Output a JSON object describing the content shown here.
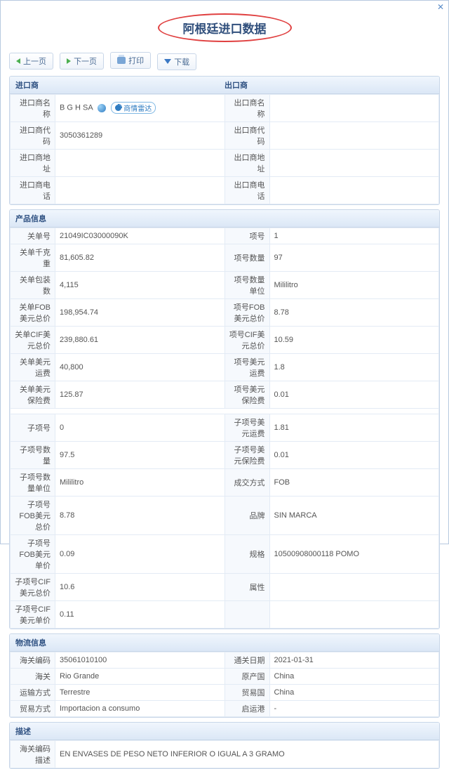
{
  "title": "阿根廷进口数据",
  "toolbar": {
    "prev": "上一页",
    "next": "下一页",
    "print": "打印",
    "download": "下载"
  },
  "sections": {
    "importer": "进口商",
    "exporter": "出口商",
    "product": "产品信息",
    "logistics": "物流信息",
    "description": "描述"
  },
  "radar_label": "商情雷达",
  "imp": {
    "name_lbl": "进口商名称",
    "name_val": "B G H SA",
    "code_lbl": "进口商代码",
    "code_val": "3050361289",
    "addr_lbl": "进口商地址",
    "addr_val": "",
    "tel_lbl": "进口商电话",
    "tel_val": ""
  },
  "exp": {
    "name_lbl": "出口商名称",
    "name_val": "",
    "code_lbl": "出口商代码",
    "code_val": "",
    "addr_lbl": "出口商地址",
    "addr_val": "",
    "tel_lbl": "出口商电话",
    "tel_val": ""
  },
  "prod": {
    "r0a_lbl": "关单号",
    "r0a_val": "21049IC03000090K",
    "r0b_lbl": "项号",
    "r0b_val": "1",
    "r1a_lbl": "关单千克重",
    "r1a_val": "81,605.82",
    "r1b_lbl": "项号数量",
    "r1b_val": "97",
    "r2a_lbl": "关单包装数",
    "r2a_val": "4,115",
    "r2b_lbl": "项号数量单位",
    "r2b_val": "Mililitro",
    "r3a_lbl": "关单FOB美元总价",
    "r3a_val": "198,954.74",
    "r3b_lbl": "项号FOB美元总价",
    "r3b_val": "8.78",
    "r4a_lbl": "关单CIF美元总价",
    "r4a_val": "239,880.61",
    "r4b_lbl": "项号CIF美元总价",
    "r4b_val": "10.59",
    "r5a_lbl": "关单美元运费",
    "r5a_val": "40,800",
    "r5b_lbl": "项号美元运费",
    "r5b_val": "1.8",
    "r6a_lbl": "关单美元保险费",
    "r6a_val": "125.87",
    "r6b_lbl": "项号美元保险费",
    "r6b_val": "0.01",
    "s0a_lbl": "子项号",
    "s0a_val": "0",
    "s0b_lbl": "子项号美元运费",
    "s0b_val": "1.81",
    "s1a_lbl": "子项号数量",
    "s1a_val": "97.5",
    "s1b_lbl": "子项号美元保险费",
    "s1b_val": "0.01",
    "s2a_lbl": "子项号数量单位",
    "s2a_val": "Mililitro",
    "s2b_lbl": "成交方式",
    "s2b_val": "FOB",
    "s3a_lbl": "子项号FOB美元总价",
    "s3a_val": "8.78",
    "s3b_lbl": "品牌",
    "s3b_val": "SIN MARCA",
    "s4a_lbl": "子项号FOB美元单价",
    "s4a_val": "0.09",
    "s4b_lbl": "规格",
    "s4b_val": "10500908000118 POMO",
    "s5a_lbl": "子项号CIF美元总价",
    "s5a_val": "10.6",
    "s5b_lbl": "属性",
    "s5b_val": "",
    "s6a_lbl": "子项号CIF美元单价",
    "s6a_val": "0.11"
  },
  "log": {
    "r0a_lbl": "海关编码",
    "r0a_val": "35061010100",
    "r0b_lbl": "通关日期",
    "r0b_val": "2021-01-31",
    "r1a_lbl": "海关",
    "r1a_val": "Rio Grande",
    "r1b_lbl": "原产国",
    "r1b_val": "China",
    "r2a_lbl": "运输方式",
    "r2a_val": "Terrestre",
    "r2b_lbl": "贸易国",
    "r2b_val": "China",
    "r3a_lbl": "贸易方式",
    "r3a_val": "Importacion a consumo",
    "r3b_lbl": "启运港",
    "r3b_val": "-"
  },
  "desc": {
    "lbl": "海关编码描述",
    "val": "EN ENVASES DE PESO NETO INFERIOR O IGUAL A 3 GRAMO"
  }
}
